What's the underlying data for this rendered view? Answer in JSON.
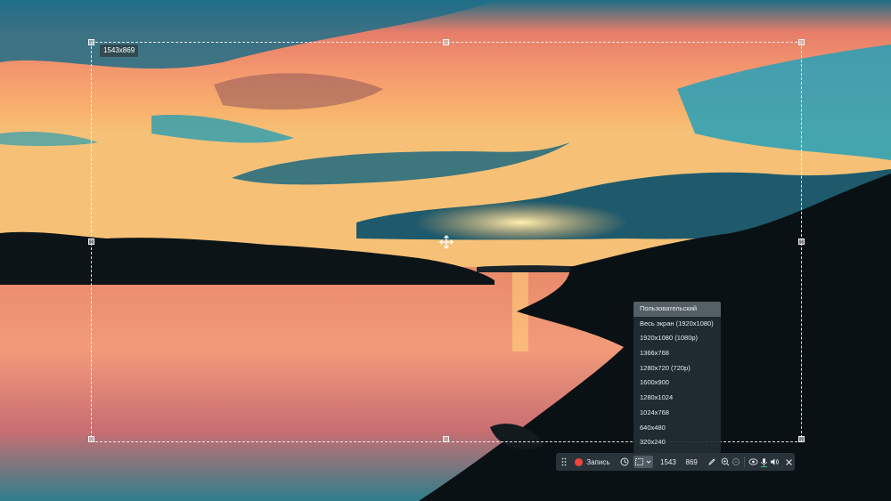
{
  "selection": {
    "size_label": "1543x869"
  },
  "dropdown": {
    "options": [
      "Пользовательский",
      "Весь экран (1920x1080)",
      "1920x1080 (1080p)",
      "1366x768",
      "1280x720 (720p)",
      "1600x900",
      "1280x1024",
      "1024x768",
      "640x480",
      "320x240"
    ],
    "selected": "Пользовательский"
  },
  "toolbar": {
    "record_label": "Запись",
    "width_value": "1543",
    "height_value": "869",
    "accent_record": "#f0443a",
    "accent_mic": "#3ac27a"
  },
  "icons": [
    "drag-grip-icon",
    "clock-icon",
    "selection-area-icon",
    "chevron-down-icon",
    "pen-icon",
    "zoom-in-icon",
    "zoom-out-icon",
    "webcam-icon",
    "microphone-icon",
    "speaker-icon",
    "close-icon",
    "move-icon"
  ]
}
